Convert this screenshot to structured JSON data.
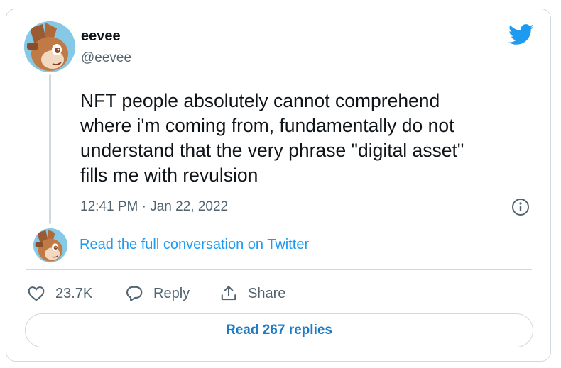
{
  "author": {
    "display_name": "eevee",
    "handle": "@eevee"
  },
  "tweet": {
    "text": "NFT people absolutely cannot comprehend\nwhere i'm coming from, fundamentally do not\nunderstand that the very phrase \"digital asset\"\nfills me with revulsion",
    "timestamp": "12:41 PM · Jan 22, 2022"
  },
  "conversation": {
    "link_label": "Read the full conversation on Twitter"
  },
  "actions": {
    "like_count": "23.7K",
    "reply_label": "Reply",
    "share_label": "Share"
  },
  "replies_button": {
    "label": "Read 267 replies"
  },
  "icons": {
    "brand": "twitter-bird-icon",
    "info": "info-icon",
    "like": "heart-icon",
    "reply": "speech-bubble-icon",
    "share": "share-upload-icon"
  },
  "colors": {
    "brand_blue": "#1d9bf0",
    "replies_text": "#1d7ac4",
    "muted_text": "#536471",
    "border": "#cfd9de"
  }
}
